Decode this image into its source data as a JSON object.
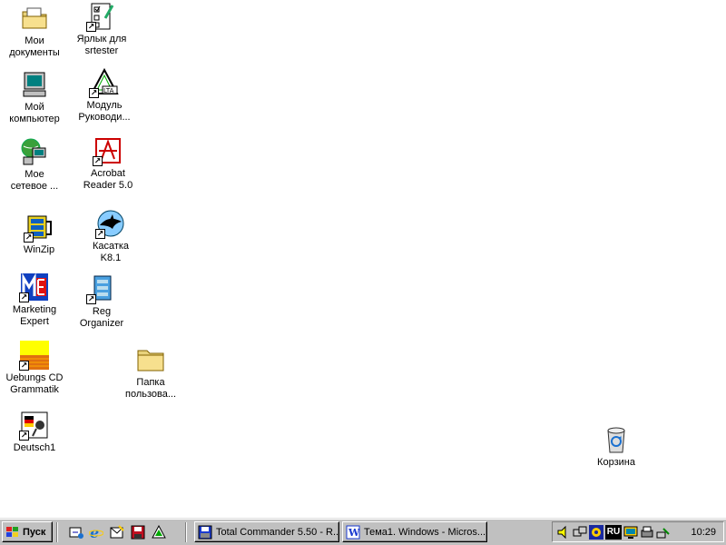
{
  "desktop": {
    "icons": [
      {
        "label": "Мои\nдокументы",
        "icon": "my-documents-folder-icon"
      },
      {
        "label": "Ярлык для\nsrtester",
        "icon": "srtester-shortcut-icon"
      },
      {
        "label": "Мой\nкомпьютер",
        "icon": "my-computer-icon"
      },
      {
        "label": "Модуль\nРуководи...",
        "icon": "ilta-module-icon"
      },
      {
        "label": "Мое\nсетевое ...",
        "icon": "network-places-icon"
      },
      {
        "label": "Acrobat\nReader 5.0",
        "icon": "acrobat-reader-icon"
      },
      {
        "label": "WinZip",
        "icon": "winzip-icon"
      },
      {
        "label": "Касатка\nK8.1",
        "icon": "kasatka-icon"
      },
      {
        "label": "Marketing\nExpert",
        "icon": "marketing-expert-icon"
      },
      {
        "label": "Reg\nOrganizer",
        "icon": "reg-organizer-icon"
      },
      {
        "label": "Uebungs CD\nGrammatik",
        "icon": "uebungs-cd-icon"
      },
      {
        "label": "Папка\nпользова...",
        "icon": "folder-icon"
      },
      {
        "label": "Deutsch1",
        "icon": "deutsch-icon"
      },
      {
        "label": "Корзина",
        "icon": "recycle-bin-icon"
      }
    ]
  },
  "taskbar": {
    "start_label": "Пуск",
    "quick_launch": [
      "show-desktop-icon",
      "internet-explorer-icon",
      "outlook-express-icon",
      "save-disk-icon",
      "ilta-icon"
    ],
    "tasks": [
      {
        "label": "Total Commander 5.50 - R...",
        "icon": "total-commander-icon"
      },
      {
        "label": "Тема1. Windows - Micros...",
        "icon": "word-document-icon"
      }
    ],
    "tray_icons": [
      "volume-icon",
      "network-icon",
      "antivirus-icon",
      "language-indicator-icon",
      "monitor-icon",
      "printer-icon",
      "connection-icon"
    ],
    "language": "RU",
    "clock": "10:29"
  }
}
